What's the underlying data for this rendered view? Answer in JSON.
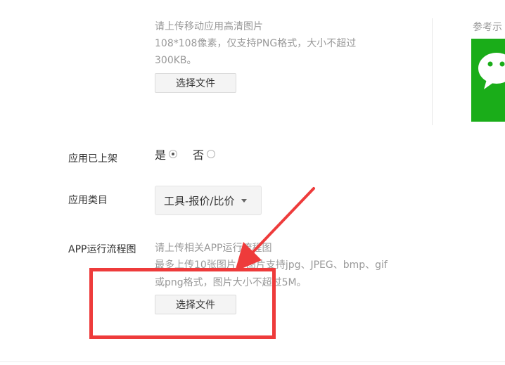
{
  "icon_upload": {
    "hint_line1": "请上传移动应用高清图片",
    "hint_line2": "108*108像素，仅支持PNG格式，大小不超过",
    "hint_line3": "300KB。",
    "button_label": "选择文件"
  },
  "sample": {
    "label": "参考示",
    "icon": "wechat-logo-icon",
    "icon_color": "#1aad19"
  },
  "listed": {
    "label": "应用已上架",
    "options": [
      {
        "label": "是",
        "checked": true
      },
      {
        "label": "否",
        "checked": false
      }
    ]
  },
  "category": {
    "label": "应用类目",
    "value": "工具-报价/比价"
  },
  "flowchart": {
    "label": "APP运行流程图",
    "hint_line1": "请上传相关APP运行流程图",
    "hint_line2": "最多上传10张图片。图片支持jpg、JPEG、bmp、gif",
    "hint_line3": "或png格式，图片大小不超过5M。",
    "button_label": "选择文件"
  },
  "annotation_color": "#ee3b3b"
}
